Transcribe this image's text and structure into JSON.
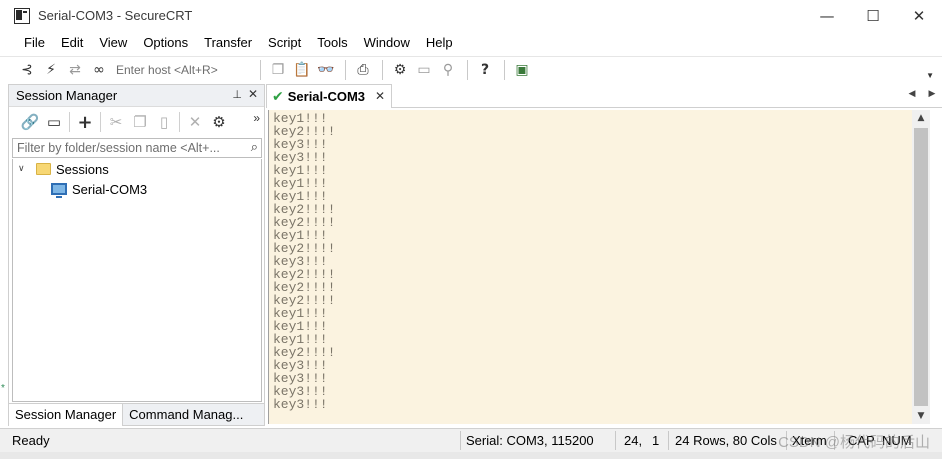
{
  "window": {
    "title": "Serial-COM3 - SecureCRT",
    "minimize": "—",
    "maximize": "☐",
    "close": "✕"
  },
  "menu": [
    "File",
    "Edit",
    "View",
    "Options",
    "Transfer",
    "Script",
    "Tools",
    "Window",
    "Help"
  ],
  "toolbar": {
    "enter_host_placeholder": "Enter host <Alt+R>",
    "icons": [
      "connect-tree-icon",
      "quick-connect-icon",
      "connect-tab-icon",
      "reconnect-icon",
      "copy-icon",
      "paste-icon",
      "find-icon",
      "print-icon",
      "options-icon",
      "keymap-icon",
      "sftp-icon",
      "help-icon",
      "about-icon"
    ]
  },
  "session_manager": {
    "title": "Session Manager",
    "pin": "📌",
    "close": "✕",
    "more": "»",
    "filter_placeholder": "Filter by folder/session name <Alt+...",
    "tree": {
      "root_label": "Sessions",
      "children": [
        "Serial-COM3"
      ]
    },
    "bottom_tabs": [
      "Session Manager",
      "Command Manag..."
    ]
  },
  "tabs": [
    {
      "label": "Serial-COM3",
      "status": "connected"
    }
  ],
  "terminal": {
    "lines": [
      "key1!!!",
      "key2!!!!",
      "key3!!!",
      "key3!!!",
      "key1!!!",
      "key1!!!",
      "key1!!!",
      "key2!!!!",
      "key2!!!!",
      "key1!!!",
      "key2!!!!",
      "key3!!!",
      "key2!!!!",
      "key2!!!!",
      "key2!!!!",
      "key1!!!",
      "key1!!!",
      "key1!!!",
      "key2!!!!",
      "key3!!!",
      "key3!!!",
      "key3!!!",
      "key3!!!"
    ],
    "background": "#fbf3e0",
    "text_color": "#7b7568"
  },
  "status": {
    "ready": "Ready",
    "connection": "Serial: COM3, 115200",
    "row": "24,",
    "col": "1",
    "size": "24 Rows, 80 Cols",
    "emulation": "Xterm",
    "caps": "CAP",
    "num": "NUM"
  },
  "watermark": "CSDN @杨代码的后山"
}
